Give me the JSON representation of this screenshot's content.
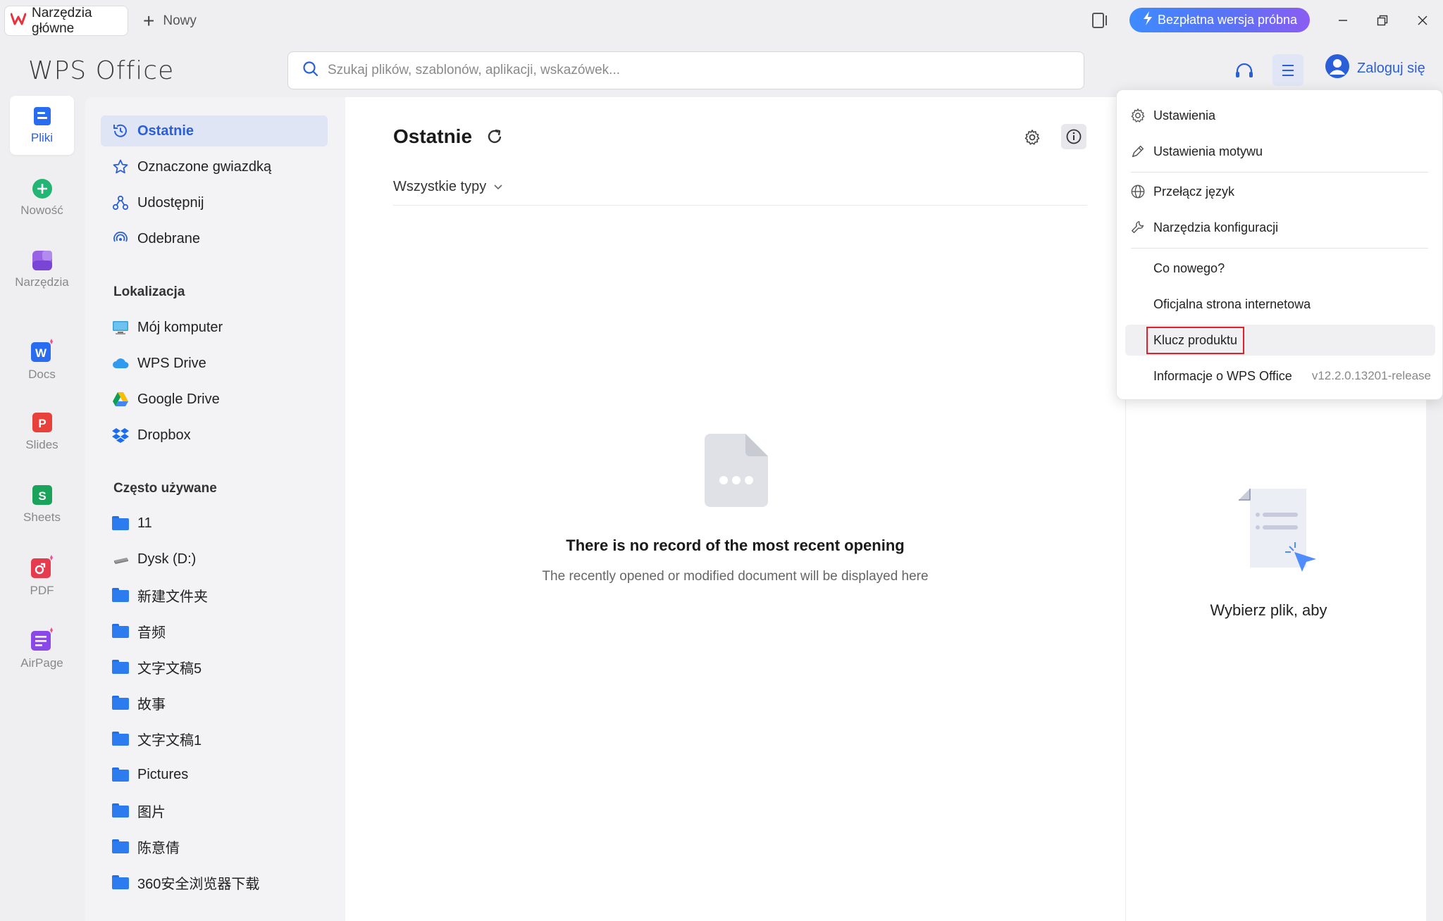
{
  "titlebar": {
    "home_tab_label": "Narzędzia główne",
    "new_tab_label": "Nowy",
    "trial_button_label": "Bezpłatna wersja próbna"
  },
  "header": {
    "logo_text": "WPS Office",
    "search_placeholder": "Szukaj plików, szablonów, aplikacji, wskazówek...",
    "login_label": "Zaloguj się"
  },
  "rail": {
    "items": [
      {
        "label": "Pliki",
        "icon": "files-icon",
        "active": true
      },
      {
        "label": "Nowość",
        "icon": "new-plus-icon"
      },
      {
        "label": "Narzędzia",
        "icon": "tools-icon"
      },
      {
        "label": "Docs",
        "icon": "docs-icon"
      },
      {
        "label": "Slides",
        "icon": "slides-icon"
      },
      {
        "label": "Sheets",
        "icon": "sheets-icon"
      },
      {
        "label": "PDF",
        "icon": "pdf-icon"
      },
      {
        "label": "AirPage",
        "icon": "airpage-icon"
      }
    ]
  },
  "sidebar": {
    "nav": [
      {
        "label": "Ostatnie",
        "icon": "recent-clock-icon",
        "active": true
      },
      {
        "label": "Oznaczone gwiazdką",
        "icon": "star-icon"
      },
      {
        "label": "Udostępnij",
        "icon": "share-icon"
      },
      {
        "label": "Odebrane",
        "icon": "received-icon"
      }
    ],
    "locations_heading": "Lokalizacja",
    "locations": [
      {
        "label": "Mój komputer",
        "icon": "computer-icon"
      },
      {
        "label": "WPS Drive",
        "icon": "cloud-icon"
      },
      {
        "label": "Google Drive",
        "icon": "google-drive-icon"
      },
      {
        "label": "Dropbox",
        "icon": "dropbox-icon"
      }
    ],
    "frequent_heading": "Często używane",
    "frequent": [
      {
        "label": "11",
        "icon": "folder-icon"
      },
      {
        "label": "Dysk (D:)",
        "icon": "drive-icon"
      },
      {
        "label": "新建文件夹",
        "icon": "folder-icon"
      },
      {
        "label": "音频",
        "icon": "folder-icon"
      },
      {
        "label": "文字文稿5",
        "icon": "folder-icon"
      },
      {
        "label": "故事",
        "icon": "folder-icon"
      },
      {
        "label": "文字文稿1",
        "icon": "folder-icon"
      },
      {
        "label": "Pictures",
        "icon": "folder-icon"
      },
      {
        "label": "图片",
        "icon": "folder-icon"
      },
      {
        "label": "陈意倩",
        "icon": "folder-icon"
      },
      {
        "label": "360安全浏览器下载",
        "icon": "folder-icon"
      }
    ]
  },
  "main": {
    "title": "Ostatnie",
    "filter_label": "Wszystkie typy",
    "empty_title": "There is no record of the most recent opening",
    "empty_subtitle": "The recently opened or modified document will be displayed here"
  },
  "preview": {
    "text": "Wybierz plik, aby"
  },
  "menu": {
    "items": {
      "settings": "Ustawienia",
      "theme": "Ustawienia motywu",
      "language": "Przełącz język",
      "config_tools": "Narzędzia konfiguracji",
      "whats_new": "Co nowego?",
      "website": "Oficjalna strona internetowa",
      "product_key": "Klucz produktu",
      "about": "Informacje o WPS Office"
    },
    "version": "v12.2.0.13201-release"
  },
  "colors": {
    "accent": "#2a5fd8",
    "highlight_box": "#e0202a"
  }
}
